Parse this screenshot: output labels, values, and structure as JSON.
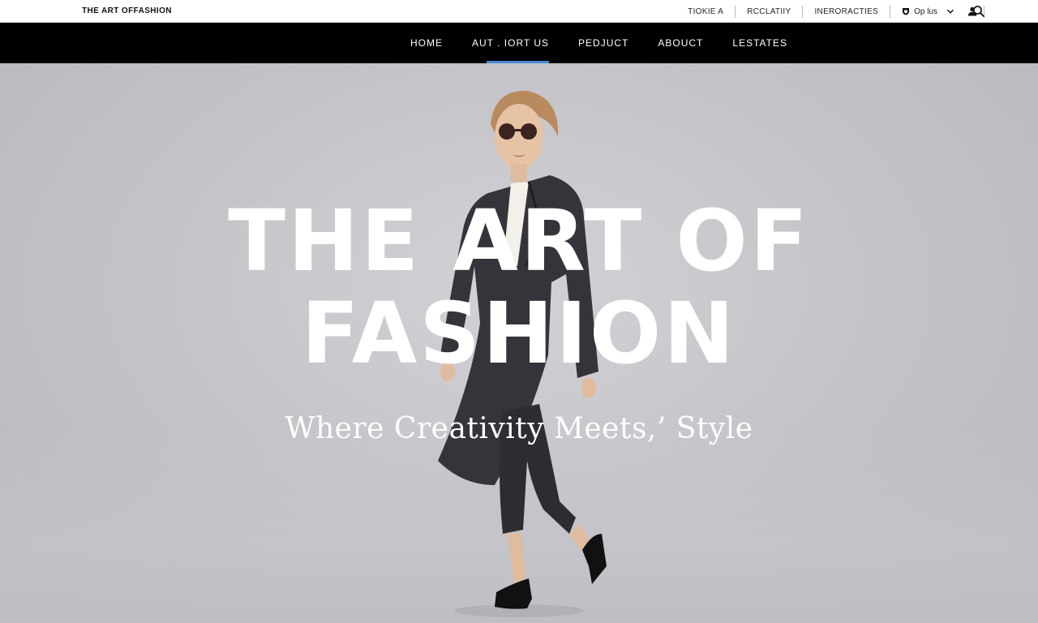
{
  "brand": "THE ART OFFASHION",
  "utility_links": [
    "TIOKIE a",
    "RCCLATIIY",
    "Ineroracties"
  ],
  "language": {
    "label": "Op lus",
    "icon": "globe-icon"
  },
  "icons": {
    "user": "user-icon",
    "search": "search-icon",
    "chevron": "chevron-down-icon"
  },
  "nav": {
    "items": [
      {
        "label": "HOME"
      },
      {
        "label": "AUT . IORT US"
      },
      {
        "label": "PEDJUCT"
      },
      {
        "label": "ABOUCT"
      },
      {
        "label": "LESTATES"
      }
    ],
    "active_index": 1
  },
  "hero": {
    "title_line1": "THE ART OF",
    "title_line2": "FASHION",
    "subtitle": "Where Creativity Meets,’ Style"
  },
  "colors": {
    "nav_background": "#000000",
    "active_indicator": "#4a88d4",
    "hero_background": "#c4c4c9",
    "hero_text": "#ffffff"
  }
}
